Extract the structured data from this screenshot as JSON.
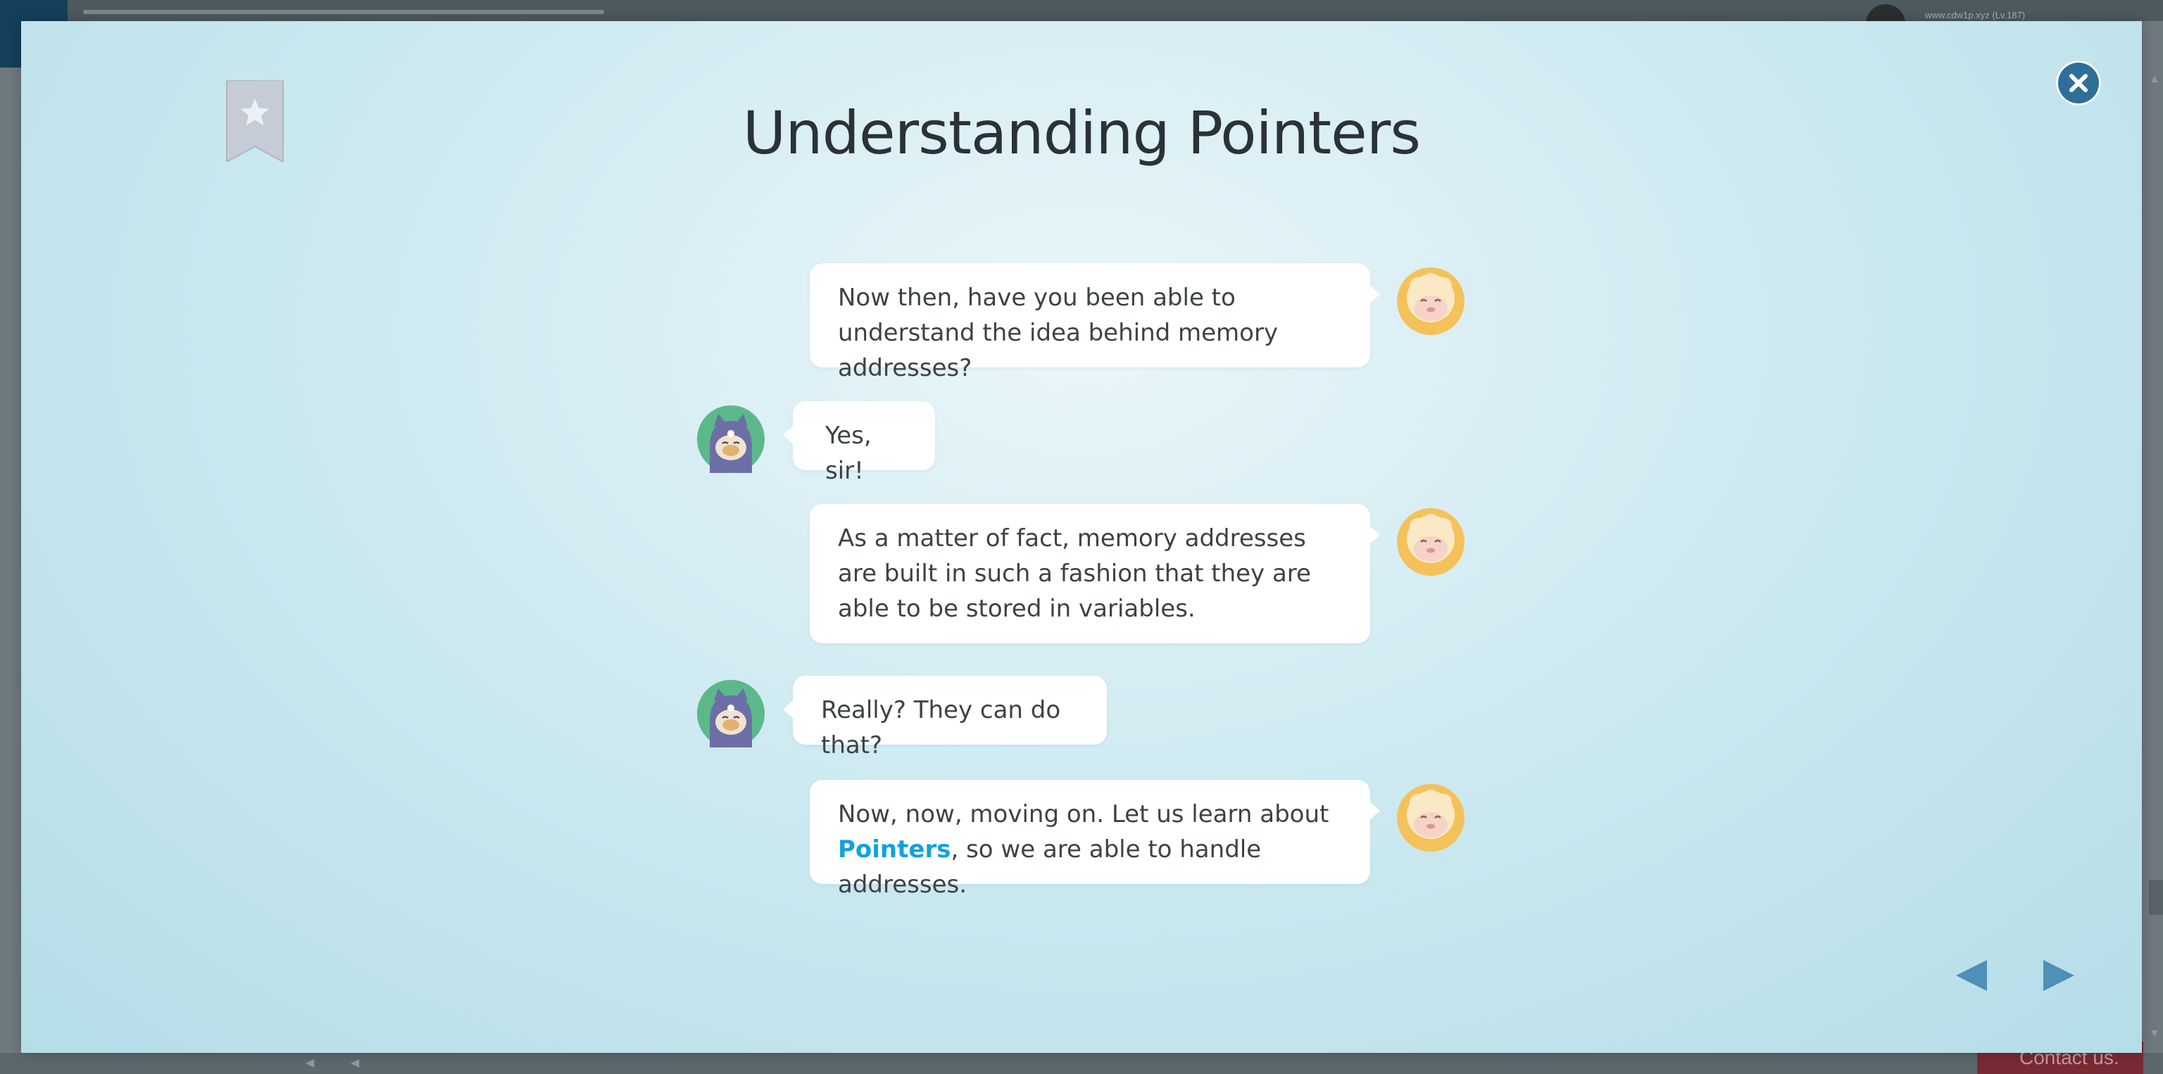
{
  "background": {
    "user_text": "www.cdw1p.xyz (Lv.187)",
    "contact_label": "Contact us."
  },
  "modal": {
    "title": "Understanding Pointers",
    "messages": [
      {
        "speaker": "sheep",
        "text": "Now then, have you been able to understand the idea behind memory addresses?"
      },
      {
        "speaker": "cat",
        "text": "Yes, sir!"
      },
      {
        "speaker": "sheep",
        "text": "As a matter of fact, memory addresses are built in such a fashion that they are able to be stored in variables."
      },
      {
        "speaker": "cat",
        "text": "Really? They can do that?"
      },
      {
        "speaker": "sheep",
        "text_before": "Now, now, moving on. Let us learn about ",
        "highlight": "Pointers",
        "text_after": ", so we are able to handle addresses."
      }
    ]
  },
  "icons": {
    "bookmark": "bookmark-star-icon",
    "close": "close-icon",
    "prev": "triangle-left-icon",
    "next": "triangle-right-icon"
  },
  "colors": {
    "accent": "#10a3d8",
    "close_button": "#2f6e99",
    "nav_arrow": "#4f8fb8",
    "bookmark": "#c6ccd6"
  }
}
